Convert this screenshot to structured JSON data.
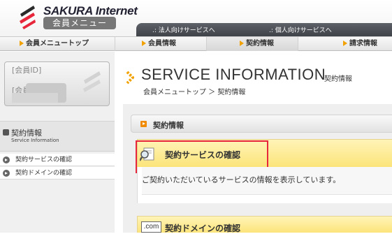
{
  "brand": {
    "name": "SAKURA Internet",
    "sub": "会員メニュー"
  },
  "toplinks": [
    "法人向けサービスへ",
    "個人向けサービスへ"
  ],
  "nav": [
    "会員メニュートップ",
    "会員情報",
    "契約情報",
    "請求情報"
  ],
  "account": {
    "id_label": "[会員ID]",
    "name_label": "[会員名]"
  },
  "sidebar": {
    "title": "契約情報",
    "subtitle": "Service Information",
    "items": [
      "契約サービスの確認",
      "契約ドメインの確認"
    ]
  },
  "page": {
    "title": "SERVICE INFORMATION",
    "title_sub": "契約情報",
    "breadcrumb": "会員メニュートップ ＞ 契約情報"
  },
  "section": {
    "label": "契約情報"
  },
  "services": {
    "heading": "契約サービスの確認",
    "description": "ご契約いただいているサービスの情報を表示しています。"
  },
  "domains": {
    "badge": ".com",
    "heading": "契約ドメインの確認"
  },
  "colors": {
    "accent": "#f08a00",
    "highlight": "#e8263b",
    "panel": "#fce47a"
  }
}
